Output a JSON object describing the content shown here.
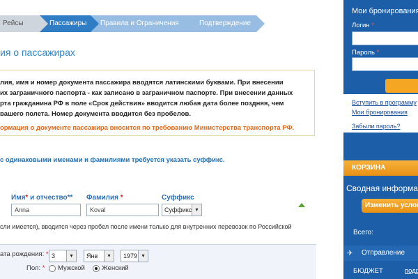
{
  "steps": [
    {
      "label": "Рейсы"
    },
    {
      "label": "Пассажиры"
    },
    {
      "label": "Правила и Ограничения"
    },
    {
      "label": "Подтверждение"
    }
  ],
  "page_title": "ия о пассажирах",
  "notice": {
    "line1": "лия, имя и номер документа пассажира вводятся латинскими буквами. При внесении",
    "line2": "их заграничного паспорта - как записано в заграничном паспорте. При внесении данных",
    "line3": "рта гражданина РФ в поле «Срок действия» вводится любая дата более поздняя, чем",
    "line4": "вашего полета. Номер документа вводится без пробелов.",
    "warning": "ормация о документе пассажира вносится по требованию Министерства транспорта РФ."
  },
  "suffix_note": "с одинаковыми именами и фамилиями требуется указать суффикс.",
  "form": {
    "first_name_label": "Имя",
    "first_name_label_rest": " и отчество**",
    "first_name_value": "Anna",
    "last_name_label": "Фамилия",
    "last_name_value": "Koval",
    "suffix_label": "Суффикс",
    "suffix_value": "Суффикс",
    "patronymic_note": "сли имеется), вводится через пробел после имени только для внутренних перевозок по Российской",
    "dob_label": "ата рождения:",
    "dob_day": "3",
    "dob_month": "Янв",
    "dob_year": "1979",
    "gender_label": "Пол:",
    "gender_male": "Мужской",
    "gender_female": "Женский"
  },
  "sidebar": {
    "title": "Мои бронирования",
    "login_label": "Логин",
    "password_label": "Пароль",
    "link_join": "Вступить в программу",
    "link_bookings": "Мои бронирования",
    "link_forgot": "Забыли пароль?",
    "cart_label": "КОРЗИНА",
    "summary_title": "Сводная информац",
    "change_button": "Изменить услов",
    "total_label": "Всего:",
    "departure_label": "Отправление",
    "budget_label": "БЮДЖЕТ",
    "budget_link": "подр"
  },
  "asterisk": "*",
  "dropdown_glyph": "▾",
  "plane_glyph": "✈"
}
